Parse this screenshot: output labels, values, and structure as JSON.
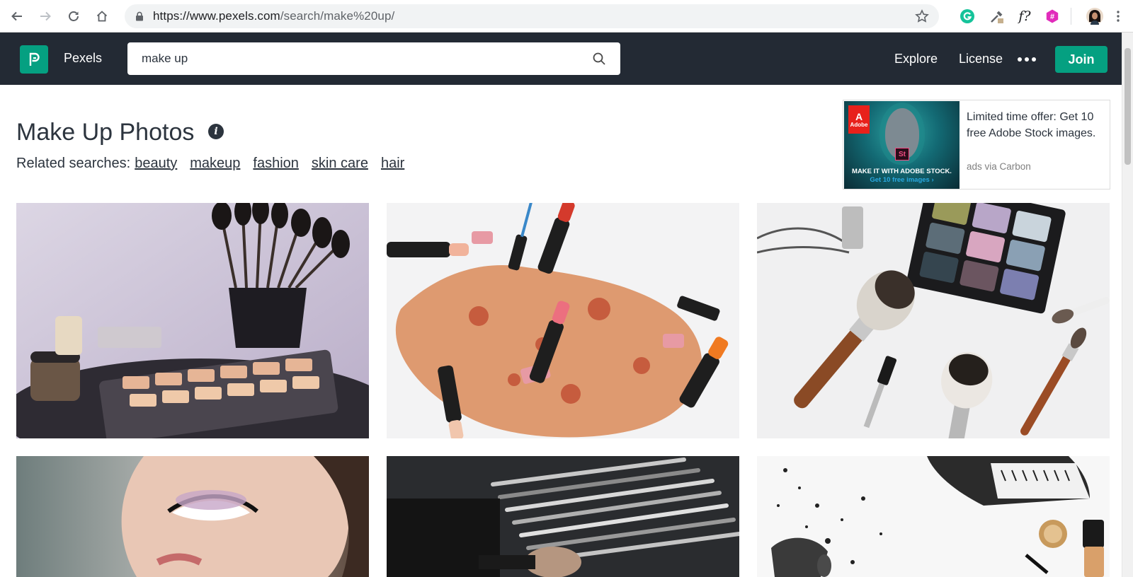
{
  "browser": {
    "url_host": "https://www.pexels.com",
    "url_path": "/search/make%20up/",
    "extension_label": "f?"
  },
  "header": {
    "brand": "Pexels",
    "search_value": "make up",
    "nav": {
      "explore": "Explore",
      "license": "License"
    },
    "join_label": "Join"
  },
  "page": {
    "title": "Make Up Photos",
    "related_label": "Related searches:",
    "related": [
      "beauty",
      "makeup",
      "fashion",
      "skin care",
      "hair"
    ]
  },
  "ad": {
    "badge_text": "Adobe",
    "st_label": "St",
    "cta_line1": "MAKE IT WITH ADOBE STOCK.",
    "cta_line2": "Get 10 free images ›",
    "text": "Limited time offer: Get 10 free Adobe Stock images.",
    "via": "ads via Carbon"
  },
  "colors": {
    "brand_green": "#05a081",
    "header_bg": "#232a34"
  },
  "photos": [
    {
      "subject": "makeup brushes and palette"
    },
    {
      "subject": "crushed powder and lipsticks"
    },
    {
      "subject": "eyeshadow palette and brushes"
    },
    {
      "subject": "woman with eye makeup"
    },
    {
      "subject": "makeup brushes in dark case"
    },
    {
      "subject": "cosmetics flat lay"
    }
  ]
}
